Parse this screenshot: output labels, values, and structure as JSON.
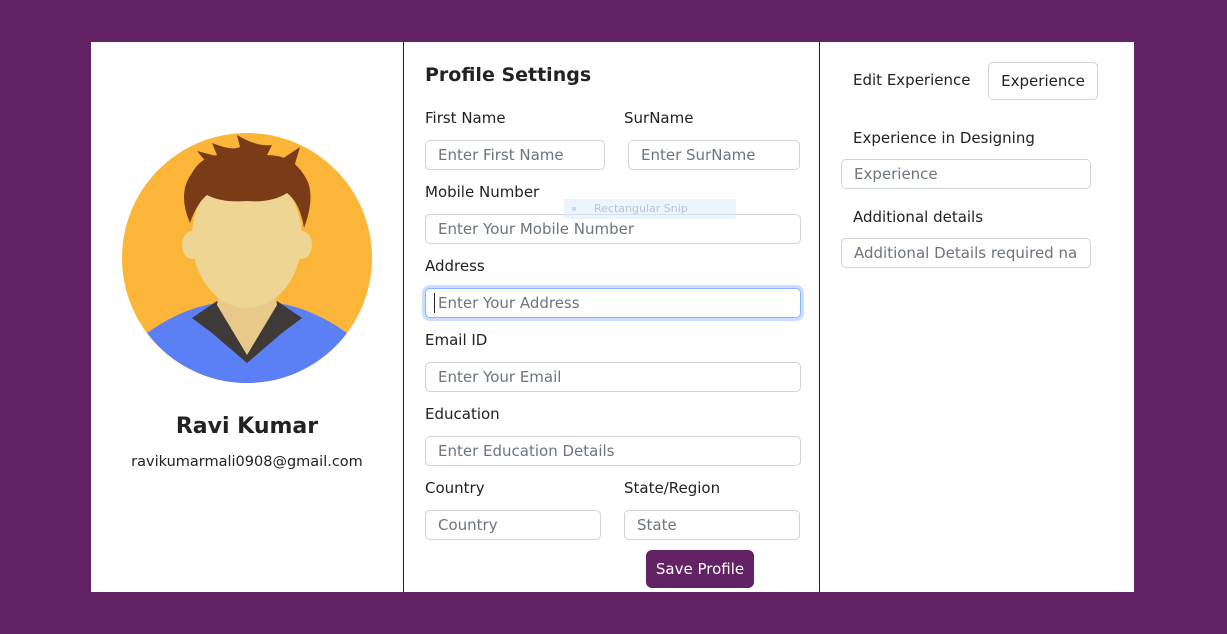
{
  "profile": {
    "name": "Ravi Kumar",
    "email": "ravikumarmali0908@gmail.com"
  },
  "form": {
    "title": "Profile Settings",
    "first_name": {
      "label": "First Name",
      "placeholder": "Enter First Name"
    },
    "surname": {
      "label": "SurName",
      "placeholder": "Enter SurName"
    },
    "mobile": {
      "label": "Mobile Number",
      "placeholder": "Enter Your Mobile Number"
    },
    "address": {
      "label": "Address",
      "placeholder": "Enter Your Address"
    },
    "email": {
      "label": "Email ID",
      "placeholder": "Enter Your Email"
    },
    "education": {
      "label": "Education",
      "placeholder": "Enter Education Details"
    },
    "country": {
      "label": "Country",
      "placeholder": "Country"
    },
    "state": {
      "label": "State/Region",
      "placeholder": "State"
    },
    "save_label": "Save Profile"
  },
  "overlay": {
    "snip_label": "Rectangular Snip"
  },
  "experience": {
    "edit_label": "Edit Experience",
    "button_label": "Experience",
    "designing_label": "Experience in Designing",
    "designing_placeholder": "Experience",
    "additional_label": "Additional details",
    "additional_placeholder": "Additional Details required nam"
  },
  "colors": {
    "background": "#632263",
    "button": "#632263",
    "avatar_circle": "#fbb63a",
    "shirt": "#5b7ff5"
  }
}
